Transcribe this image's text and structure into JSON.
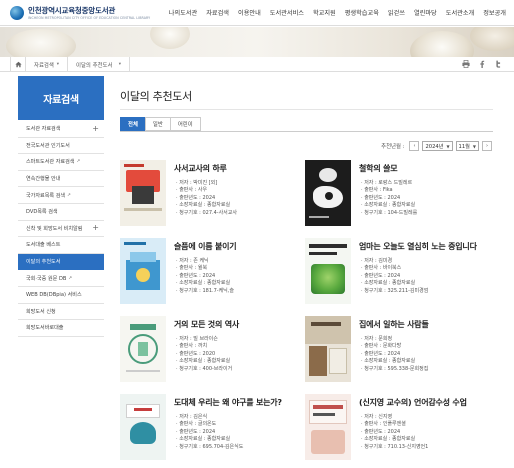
{
  "header": {
    "logo_title": "인천광역시교육청중앙도서관",
    "logo_sub": "INCHEON METROPOLITAN CITY OFFICE OF EDUCATION CENTRAL LIBRARY",
    "menu": [
      "나의도서관",
      "자료검색",
      "이용안내",
      "도서관서비스",
      "학교지원",
      "평생학습교육",
      "읽걷쓰",
      "열린마당",
      "도서관소개",
      "정보공개"
    ]
  },
  "breadcrumb": {
    "home_icon": "home-icon",
    "items": [
      "자료검색",
      "이달의 추천도서"
    ]
  },
  "tools": [
    "print-icon",
    "facebook-icon",
    "twitter-icon"
  ],
  "sidebar": {
    "title": "자료검색",
    "items": [
      {
        "label": "도서관 자료검색",
        "plus": "+",
        "ext": ""
      },
      {
        "label": "전국도서관 인기도서",
        "plus": "",
        "ext": ""
      },
      {
        "label": "스마트도서관 자료검색",
        "plus": "",
        "ext": "↗"
      },
      {
        "label": "연속간행물 안내",
        "plus": "",
        "ext": ""
      },
      {
        "label": "국가자료목록 검색",
        "plus": "",
        "ext": "↗"
      },
      {
        "label": "DVD목록 검색",
        "plus": "",
        "ext": ""
      },
      {
        "label": "신착 및 희망도서 비치알림",
        "plus": "+",
        "ext": ""
      },
      {
        "label": "도서대출 베스트",
        "plus": "",
        "ext": ""
      },
      {
        "label": "이달의 추천도서",
        "plus": "",
        "ext": ""
      },
      {
        "label": "국회·국중 원문 DB",
        "plus": "",
        "ext": "↗"
      },
      {
        "label": "WEB DB(DBpia) 서비스",
        "plus": "",
        "ext": ""
      },
      {
        "label": "희망도서 신청",
        "plus": "",
        "ext": ""
      },
      {
        "label": "희망도서바로대출",
        "plus": "",
        "ext": ""
      }
    ],
    "active_index": 8
  },
  "main": {
    "title": "이달의 추천도서",
    "tabs": [
      "전체",
      "일반",
      "어린이"
    ],
    "active_tab": 0,
    "month_label": "추천년월 :",
    "year": "2024년",
    "month": "11월",
    "prev": "‹",
    "next": "›"
  },
  "books": [
    {
      "title": "사서교사의 하루",
      "meta": [
        "저자 : 박미진 [외]",
        "출판사 : 사우",
        "출판년도 : 2024",
        "소장자료실 : 종합자료실",
        "청구기호 : 027.4-사서교사"
      ]
    },
    {
      "title": "철학의 쓸모",
      "meta": [
        "저자 : 로랑스 드빌레르",
        "출판사 : Fika",
        "출판년도 : 2024",
        "소장자료실 : 종합자료실",
        "청구기호 : 104-드빌레를"
      ]
    },
    {
      "title": "슬픔에 이름 붙이기",
      "meta": [
        "저자 : 존 케닉",
        "출판사 : 윌북",
        "출판년도 : 2024",
        "소장자료실 : 종합자료실",
        "청구기호 : 181.7-케닉,슬"
      ]
    },
    {
      "title": "엄마는 오늘도 열심히 노는 중입니다",
      "meta": [
        "저자 : 김미경",
        "출판사 : 바이북스",
        "출판년도 : 2024",
        "소장자료실 : 종합자료실",
        "청구기호 : 325.211-김미경엄"
      ]
    },
    {
      "title": "거의 모든 것의 역사",
      "meta": [
        "저자 : 빌 브라이슨",
        "출판사 : 까치",
        "출판년도 : 2020",
        "소장자료실 : 종합자료실",
        "청구기호 : 400-브라이거"
      ]
    },
    {
      "title": "집에서 일하는 사람들",
      "meta": [
        "저자 : 문희정",
        "출판사 : 문화다방",
        "출판년도 : 2024",
        "소장자료실 : 종합자료실",
        "청구기호 : 595.338-문희정집"
      ]
    },
    {
      "title": "도대체 우리는 왜 야구를 보는가?",
      "meta": [
        "저자 : 김은식",
        "출판사 : 글의온도",
        "출판년도 : 2024",
        "소장자료실 : 종합자료실",
        "청구기호 : 695.704-김은식도"
      ]
    },
    {
      "title": "(신지영 교수의) 언어감수성 수업",
      "meta": [
        "저자 : 신지영",
        "출판사 : 인플루엔셜",
        "출판년도 : 2024",
        "소장자료실 : 종합자료실",
        "청구기호 : 710.13-신지영언1"
      ]
    }
  ]
}
